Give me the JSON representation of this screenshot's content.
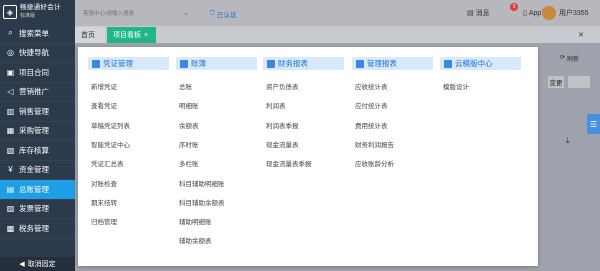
{
  "sidebar": {
    "logo_title": "畅捷通好会计",
    "logo_sub": "标准版",
    "items": [
      {
        "label": "搜索菜单",
        "icon": "search-icon"
      },
      {
        "label": "快捷导航",
        "icon": "compass-icon"
      },
      {
        "label": "项目合同",
        "icon": "contract-icon"
      },
      {
        "label": "营销推广",
        "icon": "megaphone-icon"
      },
      {
        "label": "销售管理",
        "icon": "cart-icon"
      },
      {
        "label": "采购管理",
        "icon": "bag-icon"
      },
      {
        "label": "库存核算",
        "icon": "box-icon"
      },
      {
        "label": "资金管理",
        "icon": "money-icon"
      },
      {
        "label": "总账管理",
        "icon": "ledger-icon"
      },
      {
        "label": "发票管理",
        "icon": "invoice-icon"
      },
      {
        "label": "税务管理",
        "icon": "tax-icon"
      }
    ],
    "active_index": 8,
    "footer_label": "取消固定",
    "active_color": "#1f9ee6"
  },
  "topbar": {
    "search_placeholder": "客服中心/请输入搜索",
    "auth_label": "已认证",
    "msg_label": "消息",
    "msg_count": "3",
    "app_label": "App下载",
    "user_label": "用户3355"
  },
  "tabs": {
    "home": "首页",
    "active": "项目看板",
    "close": "×"
  },
  "content": {
    "refresh_label": "刷新",
    "var_label": "变更"
  },
  "menu": {
    "columns": [
      {
        "title": "凭证管理",
        "items": [
          "新增凭证",
          "查看凭证",
          "草稿凭证列表",
          "智能凭证中心",
          "凭证汇总表",
          "对账检查",
          "期末结转",
          "归档管理"
        ]
      },
      {
        "title": "账簿",
        "items": [
          "总账",
          "明细账",
          "余额表",
          "序时账",
          "多栏账",
          "科目辅助明细账",
          "科目辅助余额表",
          "辅助明细账",
          "辅助余额表"
        ]
      },
      {
        "title": "财务报表",
        "items": [
          "资产负债表",
          "利润表",
          "利润表季报",
          "现金流量表",
          "现金流量表季报"
        ]
      },
      {
        "title": "管理报表",
        "items": [
          "应收统计表",
          "应付统计表",
          "费用统计表",
          "财务利润报告",
          "应收账龄分析"
        ]
      },
      {
        "title": "云模版中心",
        "items": [
          "模版设计"
        ]
      }
    ]
  }
}
